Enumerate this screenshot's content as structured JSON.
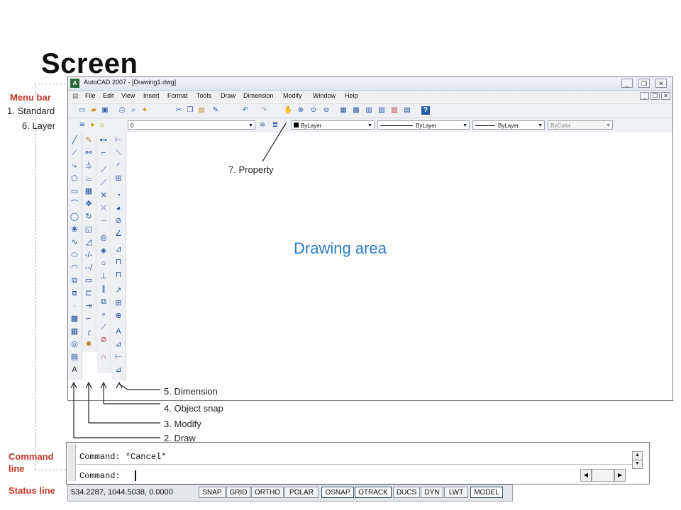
{
  "slide": {
    "title": "Screen"
  },
  "labels": {
    "menu_bar": "Menu bar",
    "standard": "1. Standard",
    "layer": "6. Layer",
    "property": "7. Property",
    "drawing_area": "Drawing area",
    "dimension": "5. Dimension",
    "object_snap": "4. Object snap",
    "modify": "3. Modify",
    "draw": "2. Draw",
    "command_line": "Command line",
    "status_line": "Status line"
  },
  "window": {
    "title": "AutoCAD 2007 - [Drawing1.dwg]",
    "menus": [
      "File",
      "Edit",
      "View",
      "Insert",
      "Format",
      "Tools",
      "Draw",
      "Dimension",
      "Modify",
      "Window",
      "Help"
    ]
  },
  "layer_toolbar": {
    "layer_value": "0",
    "color_value": "ByLayer",
    "linetype_value": "ByLayer",
    "lineweight_value": "ByLayer",
    "plotstyle_value": "ByColor"
  },
  "command": {
    "line1": "Command: *Cancel*",
    "line2": "Command:"
  },
  "status": {
    "coords": "534.2287, 1044.5038, 0.0000",
    "buttons": [
      "SNAP",
      "GRID",
      "ORTHO",
      "POLAR",
      "OSNAP",
      "OTRACK",
      "DUCS",
      "DYN",
      "LWT",
      "MODEL"
    ]
  },
  "colors": {
    "label_red": "#c0392b",
    "drawing_label_blue": "#2b7bc4"
  },
  "icons": {
    "standard_toolbar": [
      "new-icon",
      "open-icon",
      "save-icon",
      "print-icon",
      "preview-icon",
      "publish-icon",
      "cut-icon",
      "copy-icon",
      "paste-icon",
      "match-icon",
      "undo-icon",
      "redo-icon",
      "pan-icon",
      "zoom-icon",
      "properties-icon",
      "help-icon"
    ],
    "draw_toolbar": [
      "line-icon",
      "construction-line-icon",
      "polyline-icon",
      "polygon-icon",
      "rectangle-icon",
      "arc-icon",
      "circle-icon",
      "revision-cloud-icon",
      "spline-icon",
      "ellipse-icon",
      "ellipse-arc-icon",
      "insert-block-icon",
      "make-block-icon",
      "point-icon",
      "hatch-icon",
      "gradient-icon",
      "region-icon",
      "table-icon",
      "text-icon"
    ],
    "modify_toolbar": [
      "erase-icon",
      "copy-icon",
      "mirror-icon",
      "offset-icon",
      "array-icon",
      "move-icon",
      "rotate-icon",
      "scale-icon",
      "stretch-icon",
      "trim-icon",
      "extend-icon",
      "break-point-icon",
      "break-icon",
      "join-icon",
      "chamfer-icon",
      "fillet-icon",
      "explode-icon"
    ],
    "osnap_toolbar": [
      "temp-track-icon",
      "snap-from-icon",
      "endpoint-icon",
      "midpoint-icon",
      "intersection-icon",
      "apparent-intersection-icon",
      "extension-icon",
      "center-icon",
      "quadrant-icon",
      "tangent-icon",
      "perpendicular-icon",
      "parallel-icon",
      "insertion-icon",
      "node-icon",
      "nearest-icon",
      "none-icon",
      "osnap-settings-icon"
    ],
    "dimension_toolbar": [
      "linear-dim-icon",
      "aligned-dim-icon",
      "arc-length-icon",
      "ordinate-icon",
      "radius-icon",
      "jogged-icon",
      "diameter-icon",
      "angular-icon",
      "quick-dim-icon",
      "baseline-icon",
      "continue-icon",
      "leader-icon",
      "tolerance-icon",
      "center-mark-icon",
      "dim-edit-icon",
      "dim-text-edit-icon",
      "dim-update-icon",
      "dim-style-icon"
    ]
  }
}
